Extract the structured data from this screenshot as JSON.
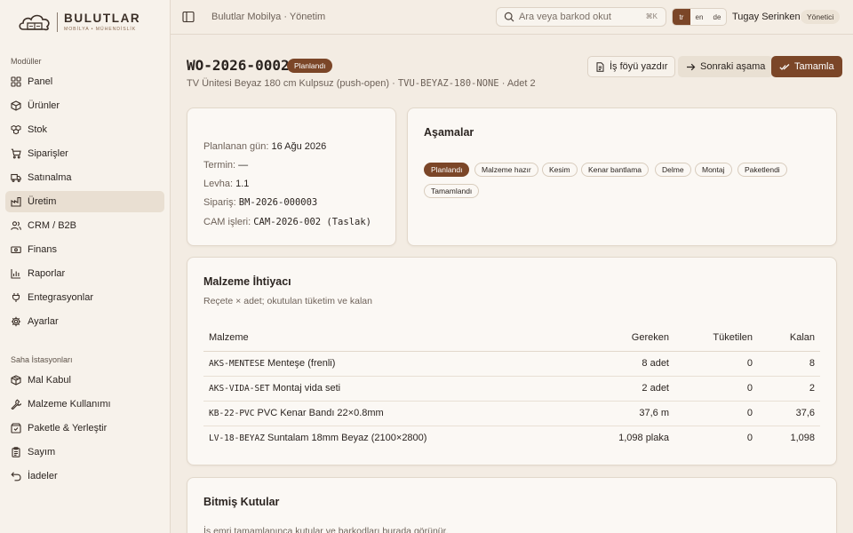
{
  "brand": {
    "name": "BULUTLAR",
    "tagline": "MOBİLYA • MÜHENDİSLİK"
  },
  "sidebar": {
    "section_modules": "Modüller",
    "modules": [
      {
        "label": "Panel",
        "icon": "grid-icon"
      },
      {
        "label": "Ürünler",
        "icon": "box-icon"
      },
      {
        "label": "Stok",
        "icon": "boxes-icon"
      },
      {
        "label": "Siparişler",
        "icon": "cart-icon"
      },
      {
        "label": "Satınalma",
        "icon": "truck-icon"
      },
      {
        "label": "Üretim",
        "icon": "factory-icon",
        "active": true
      },
      {
        "label": "CRM / B2B",
        "icon": "users-icon"
      },
      {
        "label": "Finans",
        "icon": "banknote-icon"
      },
      {
        "label": "Raporlar",
        "icon": "bar-chart-icon"
      },
      {
        "label": "Entegrasyonlar",
        "icon": "plug-icon"
      },
      {
        "label": "Ayarlar",
        "icon": "gear-icon"
      }
    ],
    "section_stations": "Saha İstasyonları",
    "stations": [
      {
        "label": "Mal Kabul",
        "icon": "package-icon"
      },
      {
        "label": "Malzeme Kullanımı",
        "icon": "wrench-icon"
      },
      {
        "label": "Paketle & Yerleştir",
        "icon": "package-check-icon"
      },
      {
        "label": "Sayım",
        "icon": "clipboard-icon"
      },
      {
        "label": "İadeler",
        "icon": "undo-icon"
      }
    ]
  },
  "topbar": {
    "title": "Bulutlar Mobilya · Yönetim",
    "search_placeholder": "Ara veya barkod okut",
    "search_shortcut": "⌘K",
    "languages": [
      "tr",
      "en",
      "de"
    ],
    "active_language": "tr",
    "user_name": "Tugay Serinken",
    "user_role": "Yönetici"
  },
  "work_order": {
    "code": "WO-2026-0002",
    "status": "Planlandı",
    "product_name": "TV Ünitesi Beyaz 180 cm Kulpsuz (push-open)",
    "sku": "TVU-BEYAZ-180-NONE",
    "quantity_text": "Adet 2",
    "actions": {
      "print": "İş föyü yazdır",
      "next": "Sonraki aşama",
      "complete": "Tamamla"
    }
  },
  "details": [
    {
      "label": "Planlanan gün:",
      "value": "16 Ağu 2026",
      "mono": false
    },
    {
      "label": "Termin:",
      "value": "—",
      "mono": false
    },
    {
      "label": "Levha:",
      "value": "1.1",
      "mono": false
    },
    {
      "label": "Sipariş:",
      "value": "BM-2026-000003",
      "mono": true
    },
    {
      "label": "CAM işleri:",
      "value": "CAM-2026-002 (Taslak)",
      "mono": true
    }
  ],
  "stages": {
    "title": "Aşamalar",
    "items": [
      "Planlandı",
      "Malzeme hazır",
      "Kesim",
      "Kenar bantlama",
      "Delme",
      "Montaj",
      "Paketlendi",
      "Tamamlandı"
    ],
    "active": "Planlandı"
  },
  "materials": {
    "title": "Malzeme İhtiyacı",
    "description": "Reçete × adet; okutulan tüketim ve kalan",
    "columns": [
      "Malzeme",
      "Gereken",
      "Tüketilen",
      "Kalan"
    ],
    "rows": [
      {
        "code": "AKS-MENTESE",
        "name": "Menteşe (frenli)",
        "required": "8 adet",
        "consumed": "0",
        "remaining": "8"
      },
      {
        "code": "AKS-VIDA-SET",
        "name": "Montaj vida seti",
        "required": "2 adet",
        "consumed": "0",
        "remaining": "2"
      },
      {
        "code": "KB-22-PVC",
        "name": "PVC Kenar Bandı 22×0.8mm",
        "required": "37,6 m",
        "consumed": "0",
        "remaining": "37,6"
      },
      {
        "code": "LV-18-BEYAZ",
        "name": "Suntalam 18mm Beyaz (2100×2800)",
        "required": "1,098 plaka",
        "consumed": "0",
        "remaining": "1,098"
      }
    ]
  },
  "finished_boxes": {
    "title": "Bitmiş Kutular",
    "description": "İş emri tamamlanınca kutular ve barkodları burada görünür."
  },
  "colors": {
    "accent": "#7b4628",
    "background": "#f3ece3",
    "card": "#fbf8f4"
  }
}
